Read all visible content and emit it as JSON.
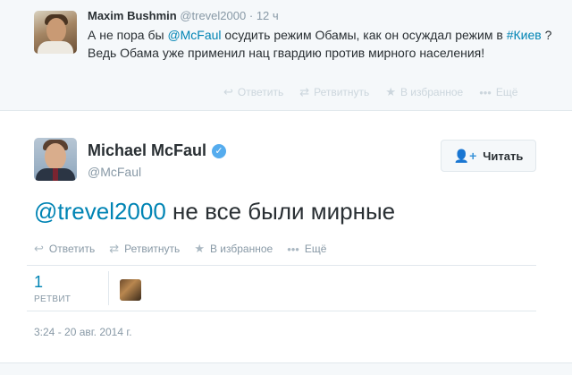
{
  "parent_tweet": {
    "name": "Maxim Bushmin",
    "handle": "@trevel2000",
    "separator": "·",
    "time": "12 ч",
    "text_parts": [
      {
        "text": "А не пора бы ",
        "link": false
      },
      {
        "text": "@McFaul",
        "link": true
      },
      {
        "text": " осудить режим Обамы, как он осуждал режим в ",
        "link": false
      },
      {
        "text": "#Киев",
        "link": true
      },
      {
        "text": " ? Ведь Обама уже применил нац гвардию против мирного населения!",
        "link": false
      }
    ],
    "actions": {
      "reply": "Ответить",
      "retweet": "Ретвитнуть",
      "favorite": "В избранное",
      "more": "Ещё"
    }
  },
  "main_tweet": {
    "name": "Michael McFaul",
    "handle": "@McFaul",
    "follow_label": "Читать",
    "text_mention": "@trevel2000",
    "text_body": " не все были мирные",
    "actions": {
      "reply": "Ответить",
      "retweet": "Ретвитнуть",
      "favorite": "В избранное",
      "more": "Ещё"
    },
    "stats": {
      "retweet_count": "1",
      "retweet_label": "РЕТВИТ"
    },
    "timestamp": "3:24 - 20 авг. 2014 г."
  },
  "colors": {
    "link": "#0084b4",
    "verified": "#55acee",
    "muted": "#8899a6",
    "background_alt": "#f5f8fa"
  },
  "icons": {
    "reply": "reply-arrow-icon",
    "retweet": "retweet-icon",
    "favorite": "star-icon",
    "more": "dots-icon",
    "follow": "add-user-icon",
    "verified": "verified-badge-icon"
  }
}
